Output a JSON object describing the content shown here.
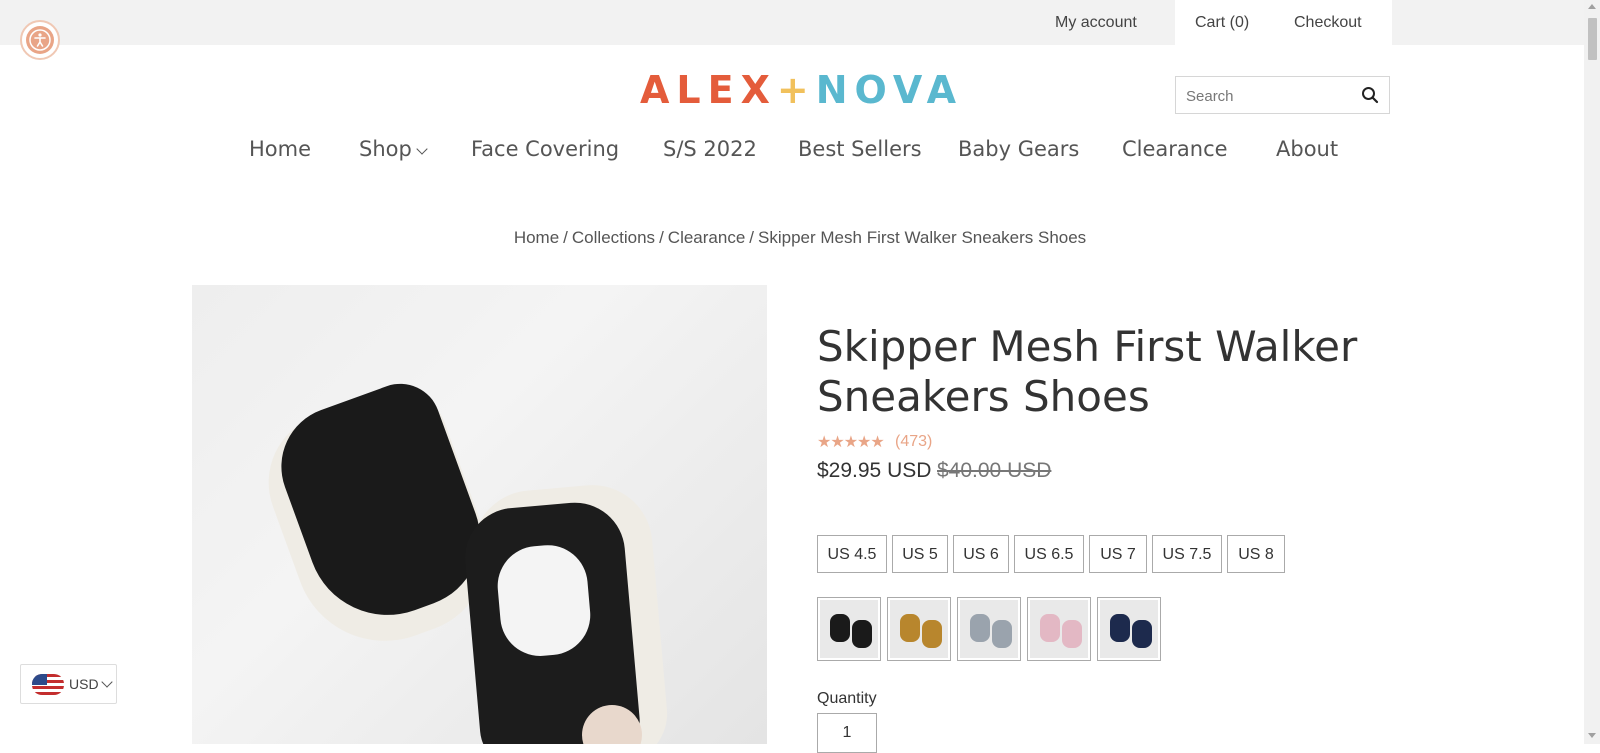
{
  "topbar": {
    "my_account": "My account",
    "cart": "Cart (0)",
    "checkout": "Checkout"
  },
  "logo": {
    "part1": "ALEX",
    "plus": "+",
    "part2": "NOVA"
  },
  "search": {
    "placeholder": "Search"
  },
  "nav": {
    "items": [
      "Home",
      "Shop",
      "Face Covering",
      "S/S 2022",
      "Best Sellers",
      "Baby Gears",
      "Clearance",
      "About"
    ]
  },
  "breadcrumb": {
    "items": [
      "Home",
      "Collections",
      "Clearance",
      "Skipper Mesh First Walker Sneakers Shoes"
    ],
    "separator": "/"
  },
  "product": {
    "title": "Skipper Mesh First Walker Sneakers Shoes",
    "stars": "★★★★★",
    "reviews": "(473)",
    "price": "$29.95 USD",
    "compare_price": "$40.00 USD",
    "sizes": [
      "US 4.5",
      "US 5",
      "US 6",
      "US 6.5",
      "US 7",
      "US 7.5",
      "US 8"
    ],
    "colors": [
      {
        "name": "black",
        "hex": "#1a1a1a"
      },
      {
        "name": "mustard",
        "hex": "#b8862d"
      },
      {
        "name": "grey",
        "hex": "#9aa3ad"
      },
      {
        "name": "pink",
        "hex": "#e3b8c4"
      },
      {
        "name": "navy",
        "hex": "#1d2a4d"
      }
    ],
    "quantity_label": "Quantity",
    "quantity_value": "1"
  },
  "currency": {
    "code": "USD"
  },
  "colors": {
    "accent": "#e9a587",
    "logo_orange": "#e45c3b",
    "logo_blue": "#5ab8cf",
    "logo_plus": "#f1c15c"
  }
}
